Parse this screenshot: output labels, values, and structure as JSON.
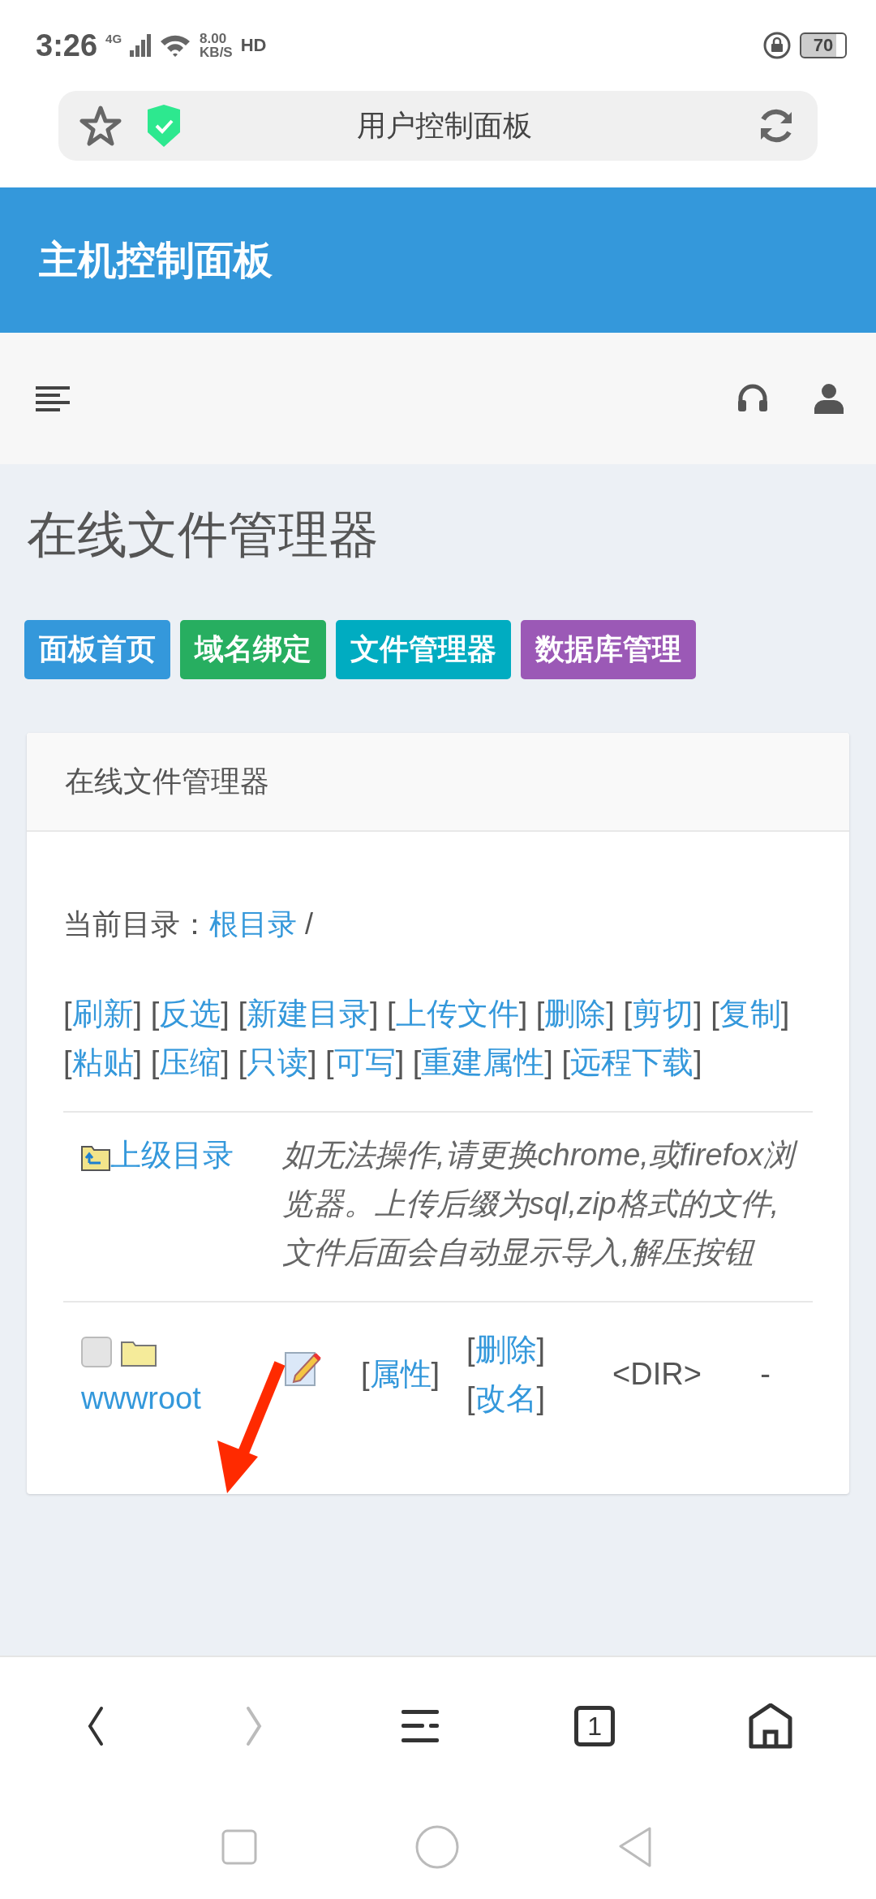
{
  "status_bar": {
    "time": "3:26",
    "network": "4G",
    "speed": "8.00",
    "speed_unit": "KB/S",
    "hd": "HD",
    "battery": "70"
  },
  "browser": {
    "title": "用户控制面板"
  },
  "header": {
    "title": "主机控制面板"
  },
  "page": {
    "heading": "在线文件管理器",
    "tabs": [
      {
        "label": "面板首页",
        "color": "#3498db"
      },
      {
        "label": "域名绑定",
        "color": "#27ae60"
      },
      {
        "label": "文件管理器",
        "color": "#00acc1"
      },
      {
        "label": "数据库管理",
        "color": "#9b59b6"
      }
    ]
  },
  "card": {
    "title": "在线文件管理器",
    "current_dir_label": "当前目录：",
    "current_dir_link": "根目录",
    "current_dir_sep": "/",
    "brackets": [
      "[",
      "]"
    ],
    "actions": [
      "刷新",
      "反选",
      "新建目录",
      "上传文件",
      "删除",
      "剪切",
      "复制",
      "粘贴",
      "压缩",
      "只读",
      "可写",
      "重建属性",
      "远程下载"
    ],
    "parent_link": "上级目录",
    "notice": "如无法操作,请更换chrome,或firefox浏览器。上传后缀为sql,zip格式的文件,文件后面会自动显示导入,解压按钮",
    "files": [
      {
        "name": "wwwroot",
        "checked": false,
        "links": [
          "属性",
          "删除",
          "改名"
        ],
        "type": "<DIR>",
        "size": "-"
      }
    ]
  },
  "toolbar": {
    "back_disabled": false,
    "forward_disabled": true,
    "tab_count": "1"
  }
}
